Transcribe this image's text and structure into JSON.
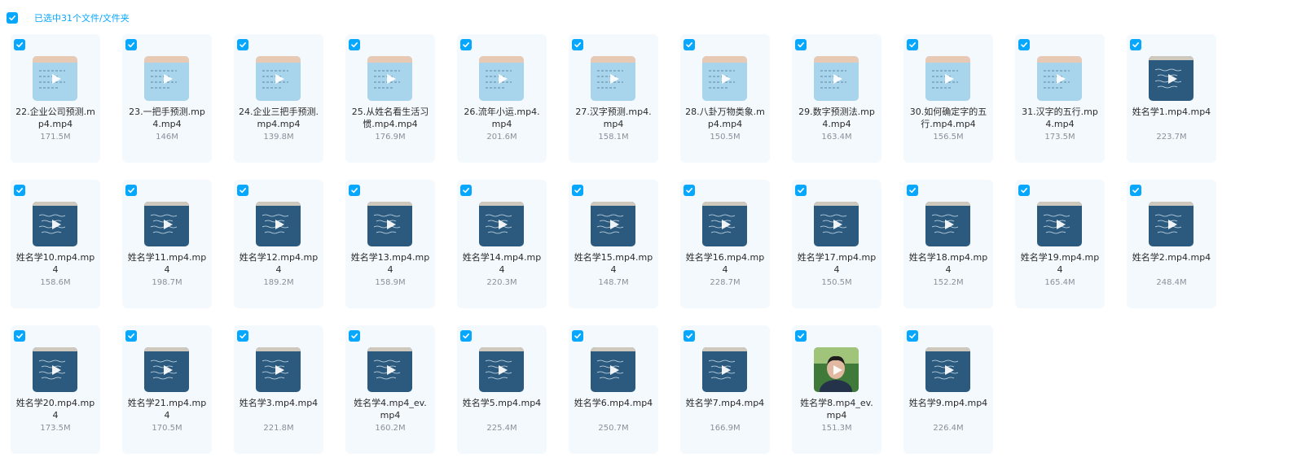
{
  "header": {
    "selection_label": "已选中31个文件/文件夹"
  },
  "colors": {
    "accent": "#06a7ff",
    "card_bg": "#f4f9fe",
    "whiteboard": "#a8d4ec",
    "blackboard": "#2c5a7e"
  },
  "files": [
    {
      "name": "22.企业公司预测.mp4.mp4",
      "size": "171.5M",
      "thumb": "whiteboard-video-thumbnail"
    },
    {
      "name": "23.一把手预测.mp4.mp4",
      "size": "146M",
      "thumb": "whiteboard-video-thumbnail"
    },
    {
      "name": "24.企业三把手预测.mp4.mp4",
      "size": "139.8M",
      "thumb": "whiteboard-video-thumbnail"
    },
    {
      "name": "25.从姓名看生活习惯.mp4.mp4",
      "size": "176.9M",
      "thumb": "whiteboard-video-thumbnail"
    },
    {
      "name": "26.流年小运.mp4.mp4",
      "size": "201.6M",
      "thumb": "whiteboard-video-thumbnail"
    },
    {
      "name": "27.汉字预测.mp4.mp4",
      "size": "158.1M",
      "thumb": "whiteboard-video-thumbnail"
    },
    {
      "name": "28.八卦万物类象.mp4.mp4",
      "size": "150.5M",
      "thumb": "whiteboard-video-thumbnail"
    },
    {
      "name": "29.数字预测法.mp4.mp4",
      "size": "163.4M",
      "thumb": "whiteboard-video-thumbnail"
    },
    {
      "name": "30.如何确定字的五行.mp4.mp4",
      "size": "156.5M",
      "thumb": "whiteboard-video-thumbnail"
    },
    {
      "name": "31.汉字的五行.mp4.mp4",
      "size": "173.5M",
      "thumb": "whiteboard-video-thumbnail"
    },
    {
      "name": "姓名学1.mp4.mp4",
      "size": "223.7M",
      "thumb": "blackboard-video-thumbnail"
    },
    {
      "name": "姓名学10.mp4.mp4",
      "size": "158.6M",
      "thumb": "blackboard-video-thumbnail"
    },
    {
      "name": "姓名学11.mp4.mp4",
      "size": "198.7M",
      "thumb": "blackboard-video-thumbnail"
    },
    {
      "name": "姓名学12.mp4.mp4",
      "size": "189.2M",
      "thumb": "blackboard-video-thumbnail"
    },
    {
      "name": "姓名学13.mp4.mp4",
      "size": "158.9M",
      "thumb": "blackboard-video-thumbnail"
    },
    {
      "name": "姓名学14.mp4.mp4",
      "size": "220.3M",
      "thumb": "blackboard-video-thumbnail"
    },
    {
      "name": "姓名学15.mp4.mp4",
      "size": "148.7M",
      "thumb": "blackboard-video-thumbnail"
    },
    {
      "name": "姓名学16.mp4.mp4",
      "size": "228.7M",
      "thumb": "blackboard-video-thumbnail"
    },
    {
      "name": "姓名学17.mp4.mp4",
      "size": "150.5M",
      "thumb": "blackboard-video-thumbnail"
    },
    {
      "name": "姓名学18.mp4.mp4",
      "size": "152.2M",
      "thumb": "blackboard-video-thumbnail"
    },
    {
      "name": "姓名学19.mp4.mp4",
      "size": "165.4M",
      "thumb": "blackboard-video-thumbnail"
    },
    {
      "name": "姓名学2.mp4.mp4",
      "size": "248.4M",
      "thumb": "blackboard-video-thumbnail"
    },
    {
      "name": "姓名学20.mp4.mp4",
      "size": "173.5M",
      "thumb": "blackboard-video-thumbnail"
    },
    {
      "name": "姓名学21.mp4.mp4",
      "size": "170.5M",
      "thumb": "blackboard-video-thumbnail"
    },
    {
      "name": "姓名学3.mp4.mp4",
      "size": "221.8M",
      "thumb": "blackboard-video-thumbnail"
    },
    {
      "name": "姓名学4.mp4_ev.mp4",
      "size": "160.2M",
      "thumb": "blackboard-video-thumbnail"
    },
    {
      "name": "姓名学5.mp4.mp4",
      "size": "225.4M",
      "thumb": "blackboard-video-thumbnail"
    },
    {
      "name": "姓名学6.mp4.mp4",
      "size": "250.7M",
      "thumb": "blackboard-video-thumbnail"
    },
    {
      "name": "姓名学7.mp4.mp4",
      "size": "166.9M",
      "thumb": "blackboard-video-thumbnail"
    },
    {
      "name": "姓名学8.mp4_ev.mp4",
      "size": "151.3M",
      "thumb": "person-video-thumbnail"
    },
    {
      "name": "姓名学9.mp4.mp4",
      "size": "226.4M",
      "thumb": "blackboard-video-thumbnail"
    }
  ]
}
